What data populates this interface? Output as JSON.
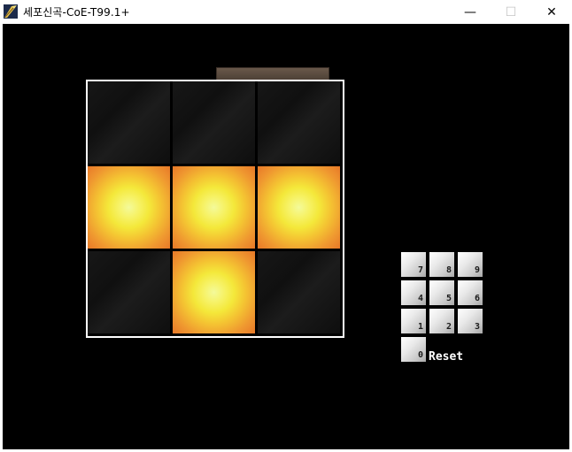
{
  "window": {
    "title": "세포신곡-CoE-T99.1+",
    "minimize_symbol": "—",
    "maximize_symbol": "☐",
    "close_symbol": "✕"
  },
  "board": {
    "rows": 3,
    "cols": 3,
    "cells": [
      [
        false,
        false,
        false
      ],
      [
        true,
        true,
        true
      ],
      [
        false,
        true,
        false
      ]
    ]
  },
  "keypad": {
    "keys": [
      {
        "label": "7"
      },
      {
        "label": "8"
      },
      {
        "label": "9"
      },
      {
        "label": "4"
      },
      {
        "label": "5"
      },
      {
        "label": "6"
      },
      {
        "label": "1"
      },
      {
        "label": "2"
      },
      {
        "label": "3"
      },
      {
        "label": "0"
      }
    ],
    "reset_label": "Reset"
  },
  "colors": {
    "background": "#000000",
    "board_border": "#ffffff",
    "tile_off": "#141414",
    "tile_on_center": "#f4fa9a",
    "tile_on_edge": "#e87828"
  }
}
